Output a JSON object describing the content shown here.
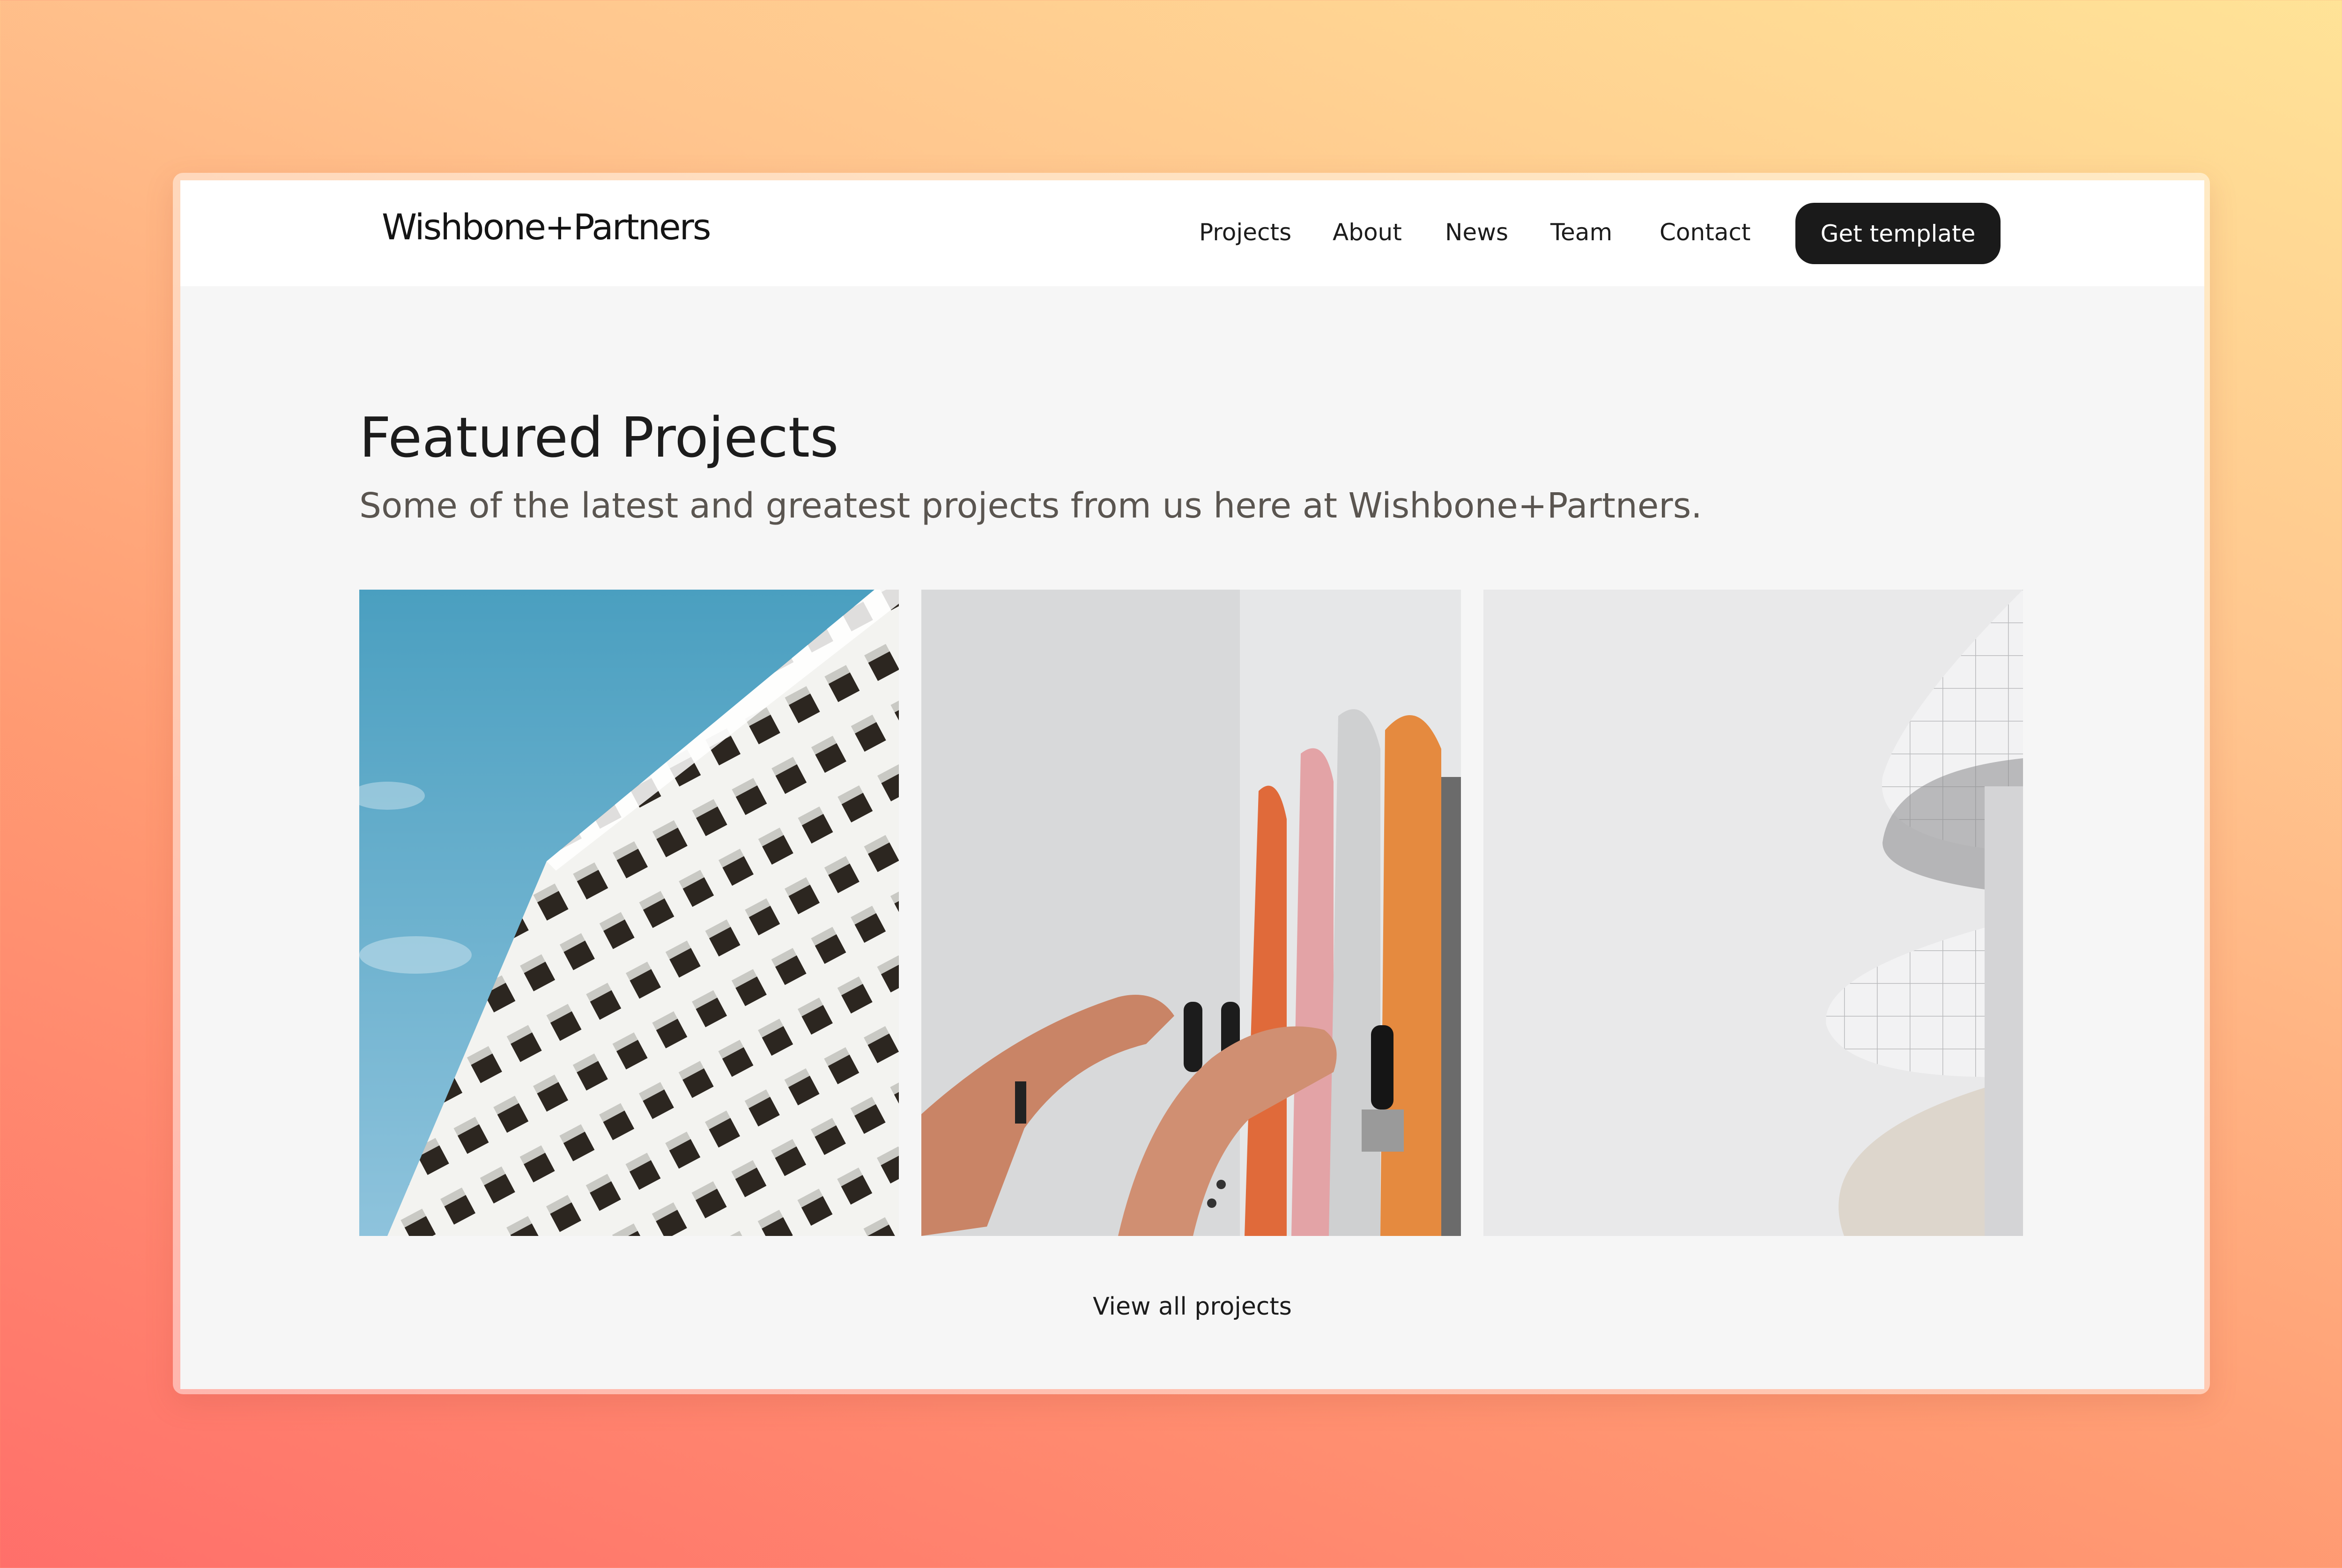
{
  "brand": {
    "name": "Wishbone+Partners"
  },
  "nav": {
    "links": [
      "Projects",
      "About",
      "News",
      "Team",
      "Contact"
    ],
    "cta_label": "Get template"
  },
  "section": {
    "title": "Featured Projects",
    "subtitle": "Some of the latest and greatest projects from us here at Wishbone+Partners.",
    "view_all_label": "View all projects"
  },
  "projects": [
    {
      "image": "building-facade-blue-sky"
    },
    {
      "image": "hands-on-beer-taps"
    },
    {
      "image": "white-curved-architecture"
    }
  ],
  "colors": {
    "cta_background": "#1a1a1a",
    "page_background": "#f6f6f6",
    "text_primary": "#1c1c1c",
    "text_secondary": "#5a5550"
  }
}
